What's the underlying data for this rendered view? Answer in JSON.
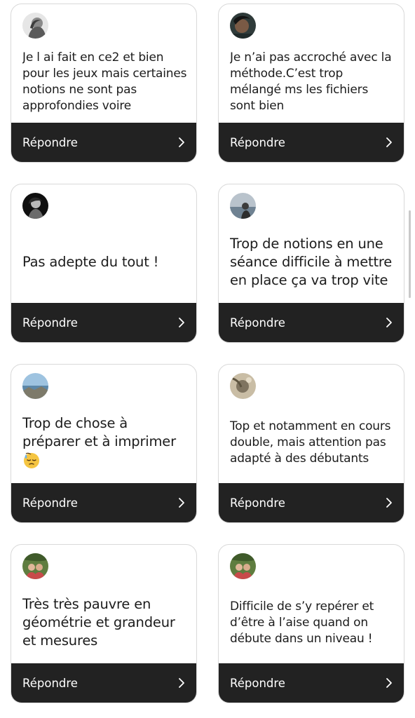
{
  "reply_label": "Répondre",
  "icons": {
    "reply_chevron": "chevron-right-icon",
    "emoji": "downcast-face-with-sweat-emoji"
  },
  "colors": {
    "reply_bar": "#222222",
    "card_border": "#d9d9d9",
    "text": "#1c1c1c"
  },
  "reviews": [
    {
      "text": "Je l ai fait en ce2 et bien pour les jeux mais certaines notions ne sont pas approfondies voire"
    },
    {
      "text": "Je n’ai pas accroché avec la méthode.C’est trop mélangé ms les fichiers sont bien"
    },
    {
      "text": "Pas adepte du tout !"
    },
    {
      "text": "Trop de notions en une séance difficile à mettre en place ça va trop vite"
    },
    {
      "text": "Trop de chose à préparer et à imprimer"
    },
    {
      "text": "Top et notamment en cours  double, mais attention pas adapté à des débutants"
    },
    {
      "text": "Très très pauvre en géométrie et grandeur et mesures"
    },
    {
      "text": "Difficile de s’y repérer et d’être à l’aise quand on débute dans un niveau !"
    }
  ]
}
